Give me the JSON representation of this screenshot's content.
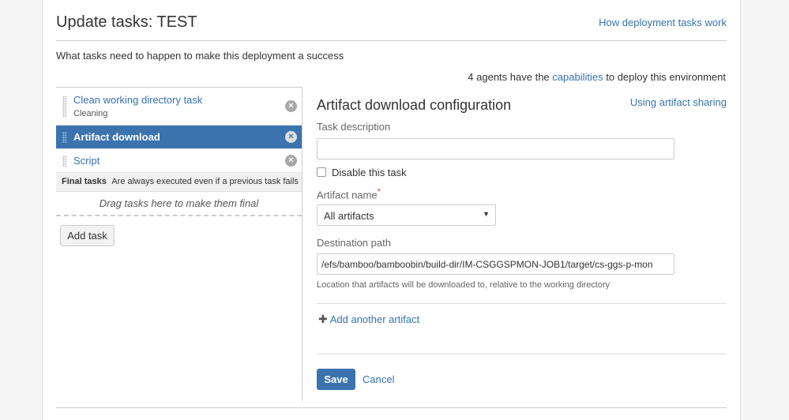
{
  "header": {
    "title": "Update tasks: TEST",
    "help_link": "How deployment tasks work"
  },
  "intro": "What tasks need to happen to make this deployment a success",
  "agents": {
    "prefix": "4 agents have the",
    "link": "capabilities",
    "suffix": "to deploy this environment"
  },
  "tasks": [
    {
      "name": "Clean working directory task",
      "subtitle": "Cleaning",
      "selected": false
    },
    {
      "name": "Artifact download",
      "subtitle": "",
      "selected": true
    },
    {
      "name": "Script",
      "subtitle": "",
      "selected": false
    }
  ],
  "final_tasks": {
    "label": "Final tasks",
    "description": "Are always executed even if a previous task fails",
    "drop_hint": "Drag tasks here to make them final"
  },
  "add_task_label": "Add task",
  "remove_glyph": "×",
  "config": {
    "title": "Artifact download configuration",
    "sharing_link": "Using artifact sharing",
    "task_description_label": "Task description",
    "task_description_value": "",
    "disable_label": "Disable this task",
    "disable_checked": false,
    "artifact_name_label": "Artifact name",
    "artifact_name_required": "*",
    "artifact_name_value": "All artifacts",
    "destination_label": "Destination path",
    "destination_value": "/efs/bamboo/bamboobin/build-dir/IM-CSGGSPMON-JOB1/target/cs-ggs-p-mon",
    "destination_help": "Location that artifacts will be downloaded to, relative to the working directory",
    "add_another": "Add another artifact",
    "save_label": "Save",
    "cancel_label": "Cancel"
  },
  "colors": {
    "accent": "#3b73af",
    "link": "#3572b0",
    "required": "#d04437"
  }
}
